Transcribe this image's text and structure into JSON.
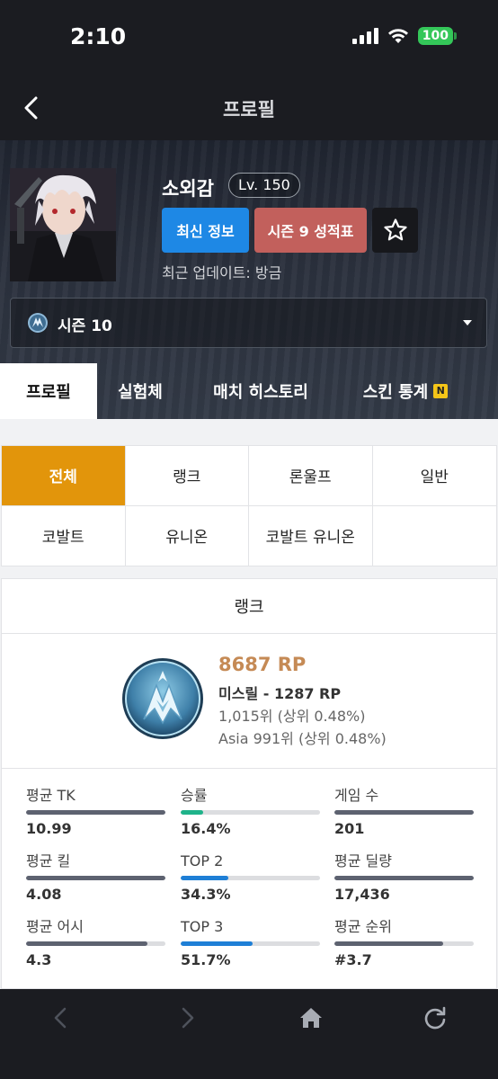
{
  "status_bar": {
    "time": "2:10",
    "battery": "100"
  },
  "nav": {
    "title": "프로필"
  },
  "profile": {
    "name": "소외감",
    "level": "Lv. 150",
    "latest_button": "최신 정보",
    "season_report_button": "시즌 9 성적표",
    "last_update": "최근 업데이트: 방금",
    "season_select": "시즌 10"
  },
  "tabs": [
    {
      "label": "프로필",
      "active": true
    },
    {
      "label": "실험체"
    },
    {
      "label": "매치 히스토리"
    },
    {
      "label": "스킨 통계",
      "badge": "N"
    }
  ],
  "filters": [
    "전체",
    "랭크",
    "론울프",
    "일반",
    "코발트",
    "유니온",
    "코발트 유니온",
    ""
  ],
  "rank": {
    "title": "랭크",
    "rp": "8687 RP",
    "tier": "미스릴 - 1287 RP",
    "global_rank": "1,015위 (상위 0.48%)",
    "region_rank": "Asia 991위 (상위 0.48%)"
  },
  "stats": [
    {
      "label": "평균 TK",
      "value": "10.99",
      "fill": 1.0,
      "color": "#5d6270"
    },
    {
      "label": "승률",
      "value": "16.4%",
      "fill": 0.164,
      "color": "#1fb38a"
    },
    {
      "label": "게임 수",
      "value": "201",
      "fill": 1.0,
      "color": "#5d6270"
    },
    {
      "label": "평균 킬",
      "value": "4.08",
      "fill": 1.0,
      "color": "#5d6270"
    },
    {
      "label": "TOP 2",
      "value": "34.3%",
      "fill": 0.343,
      "color": "#1e7fd6"
    },
    {
      "label": "평균 딜량",
      "value": "17,436",
      "fill": 1.0,
      "color": "#5d6270"
    },
    {
      "label": "평균 어시",
      "value": "4.3",
      "fill": 0.87,
      "color": "#5d6270"
    },
    {
      "label": "TOP 3",
      "value": "51.7%",
      "fill": 0.517,
      "color": "#1e7fd6"
    },
    {
      "label": "평균 순위",
      "value": "#3.7",
      "fill": 0.78,
      "color": "#5d6270"
    }
  ],
  "icons": {
    "back": "chevron-left-icon",
    "favorite": "star-icon",
    "browser": [
      "chevron-left-icon",
      "chevron-right-icon",
      "home-icon",
      "refresh-icon"
    ]
  }
}
